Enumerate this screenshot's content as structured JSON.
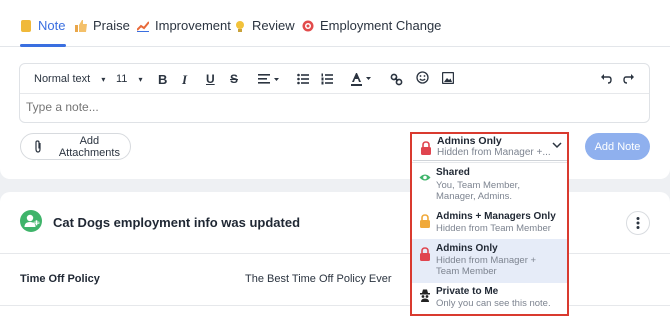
{
  "tabs": [
    {
      "label": "Note",
      "icon": "note-icon",
      "color": "#f0b93a"
    },
    {
      "label": "Praise",
      "icon": "thumbs-up-icon",
      "color": "#e9a64a"
    },
    {
      "label": "Improvement",
      "icon": "chart-up-icon",
      "color": "#e86a3a"
    },
    {
      "label": "Review",
      "icon": "lightbulb-icon",
      "color": "#f2c23a"
    },
    {
      "label": "Employment Change",
      "icon": "shield-badge-icon",
      "color": "#e24b4b"
    }
  ],
  "editor": {
    "text_style": "Normal text",
    "font_size": "11",
    "placeholder": "Type a note..."
  },
  "attach_label": "Add Attachments",
  "add_note_label": "Add Note",
  "visibility": {
    "selected_title": "Admins Only",
    "selected_desc": "Hidden from Manager +...",
    "options": [
      {
        "title": "Shared",
        "desc1": "You, Team Member,",
        "desc2": "Manager, Admins.",
        "icon": "eye-icon",
        "color": "#3fb46a"
      },
      {
        "title": "Admins + Managers Only",
        "desc1": "Hidden from Team Member",
        "desc2": "",
        "icon": "lock-icon",
        "color": "#f0a93a"
      },
      {
        "title": "Admins Only",
        "desc1": "Hidden from Manager +",
        "desc2": "Team Member",
        "icon": "lock-icon",
        "color": "#e0454f"
      },
      {
        "title": "Private to Me",
        "desc1": "Only you can see this note.",
        "desc2": "",
        "icon": "spy-icon",
        "color": "#222222"
      }
    ]
  },
  "update": {
    "title": "Cat Dogs employment info was updated",
    "field_label": "Time Off Policy",
    "field_value": "The Best Time Off Policy Ever"
  },
  "colors": {
    "accent": "#3a6fe0",
    "highlight": "#d93a2f",
    "success": "#3fb46a"
  }
}
